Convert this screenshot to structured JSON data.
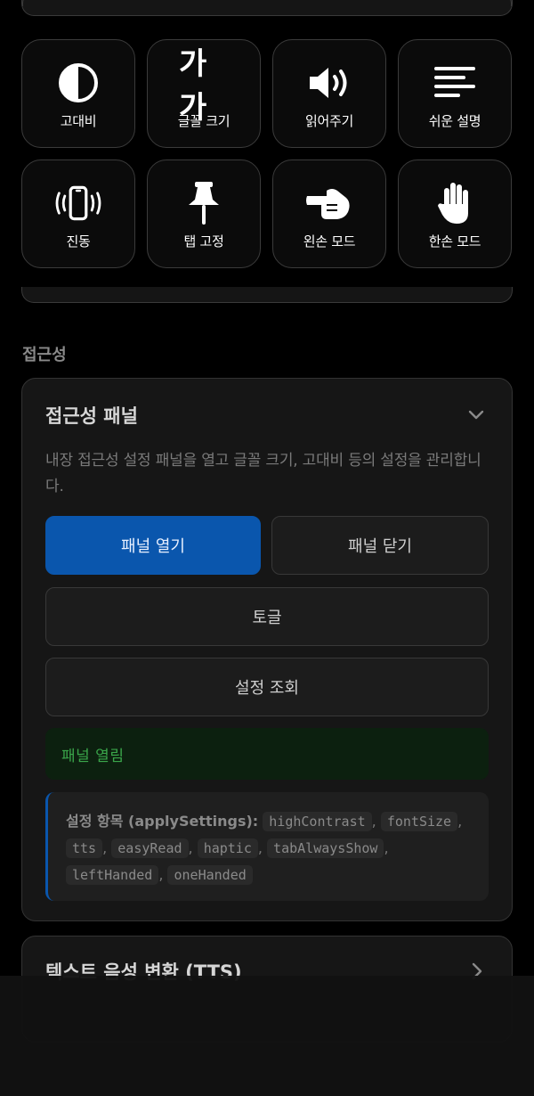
{
  "tiles": [
    {
      "label": "고대비",
      "icon": "contrast-icon"
    },
    {
      "label": "글꼴 크기",
      "icon": "font-size-icon"
    },
    {
      "label": "읽어주기",
      "icon": "speaker-icon"
    },
    {
      "label": "쉬운 설명",
      "icon": "lines-icon"
    },
    {
      "label": "진동",
      "icon": "vibration-phone-icon"
    },
    {
      "label": "탭 고정",
      "icon": "pin-icon"
    },
    {
      "label": "왼손 모드",
      "icon": "left-hand-point-icon"
    },
    {
      "label": "한손 모드",
      "icon": "hand-icon"
    }
  ],
  "font_size_glyph": "가가",
  "section": {
    "title": "접근성"
  },
  "panel": {
    "title": "접근성 패널",
    "description": "내장 접근성 설정 패널을 열고 글꼴 크기, 고대비 등의 설정을 관리합니다.",
    "buttons": {
      "open": "패널 열기",
      "close": "패널 닫기",
      "toggle": "토글",
      "query": "설정 조회"
    },
    "status": "패널 열림",
    "info_label": "설정 항목 (applySettings):",
    "settings": [
      "highContrast",
      "fontSize",
      "tts",
      "easyRead",
      "haptic",
      "tabAlwaysShow",
      "leftHanded",
      "oneHanded"
    ]
  },
  "tts_card": {
    "title": "텍스트 음성 변환 (TTS)"
  },
  "colors": {
    "primary": "#0a56ad",
    "status_green": "#3aa54a",
    "background": "#000000"
  }
}
